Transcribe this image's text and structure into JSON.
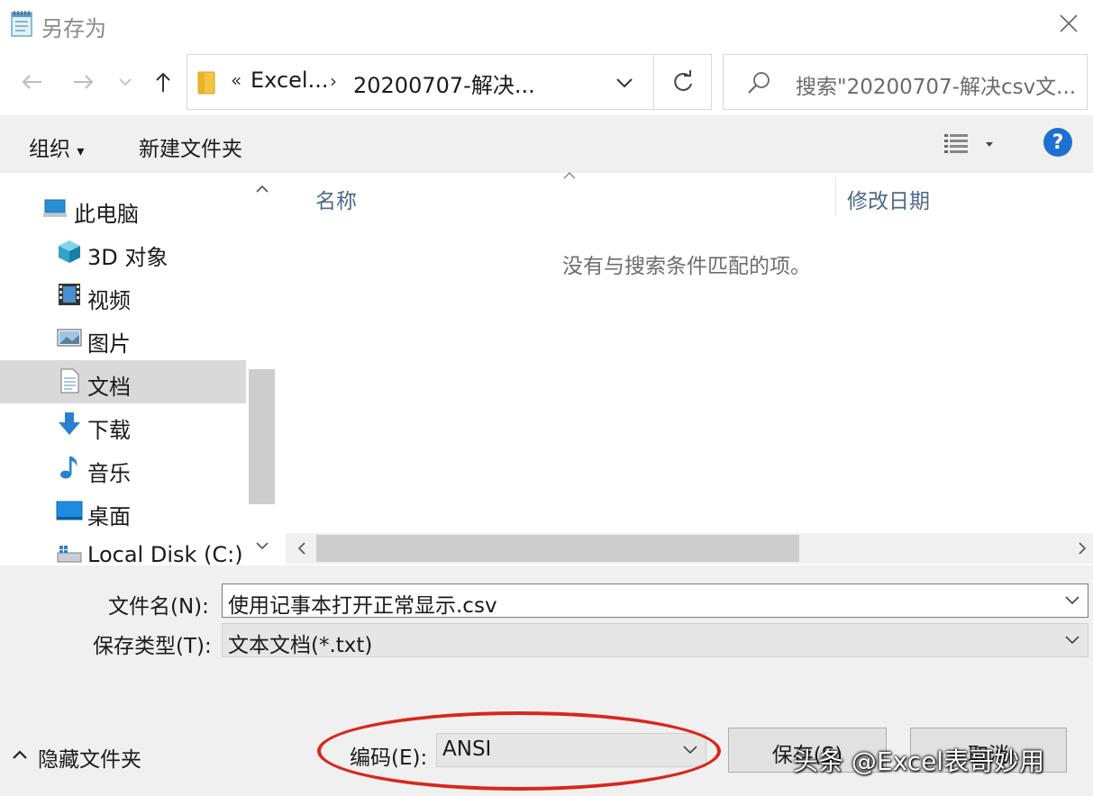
{
  "window": {
    "title": "另存为"
  },
  "nav": {
    "breadcrumb_overflow": "«",
    "breadcrumbs": [
      "Excel...",
      "20200707-解决..."
    ],
    "search_placeholder": "搜索\"20200707-解决csv文..."
  },
  "toolbar": {
    "organize_label": "组织",
    "organize_caret": "▾",
    "new_folder_label": "新建文件夹",
    "help_label": "?"
  },
  "sidebar": {
    "items": [
      {
        "label": "此电脑",
        "icon": "computer-icon"
      },
      {
        "label": "3D 对象",
        "icon": "cube-3d-icon"
      },
      {
        "label": "视频",
        "icon": "video-icon"
      },
      {
        "label": "图片",
        "icon": "pictures-icon"
      },
      {
        "label": "文档",
        "icon": "documents-icon",
        "selected": true
      },
      {
        "label": "下载",
        "icon": "download-icon"
      },
      {
        "label": "音乐",
        "icon": "music-icon"
      },
      {
        "label": "桌面",
        "icon": "desktop-icon"
      },
      {
        "label": "Local Disk (C:)",
        "icon": "disk-icon"
      }
    ]
  },
  "filelist": {
    "columns": [
      "名称",
      "修改日期"
    ],
    "empty_message": "没有与搜索条件匹配的项。"
  },
  "form": {
    "filename_label": "文件名(N):",
    "filename_value": "使用记事本打开正常显示.csv",
    "filetype_label": "保存类型(T):",
    "filetype_value": "文本文档(*.txt)",
    "encoding_label": "编码(E):",
    "encoding_value": "ANSI"
  },
  "footer": {
    "hide_folders_label": "隐藏文件夹",
    "save_button_label": "保存(S)",
    "cancel_button_label": "取消"
  },
  "watermark": {
    "text": "头条 @Excel表哥妙用"
  },
  "colors": {
    "highlight_ellipse": "#d9261c",
    "help_blue": "#1f6fd0",
    "selected_bg": "#d9d9d9"
  }
}
